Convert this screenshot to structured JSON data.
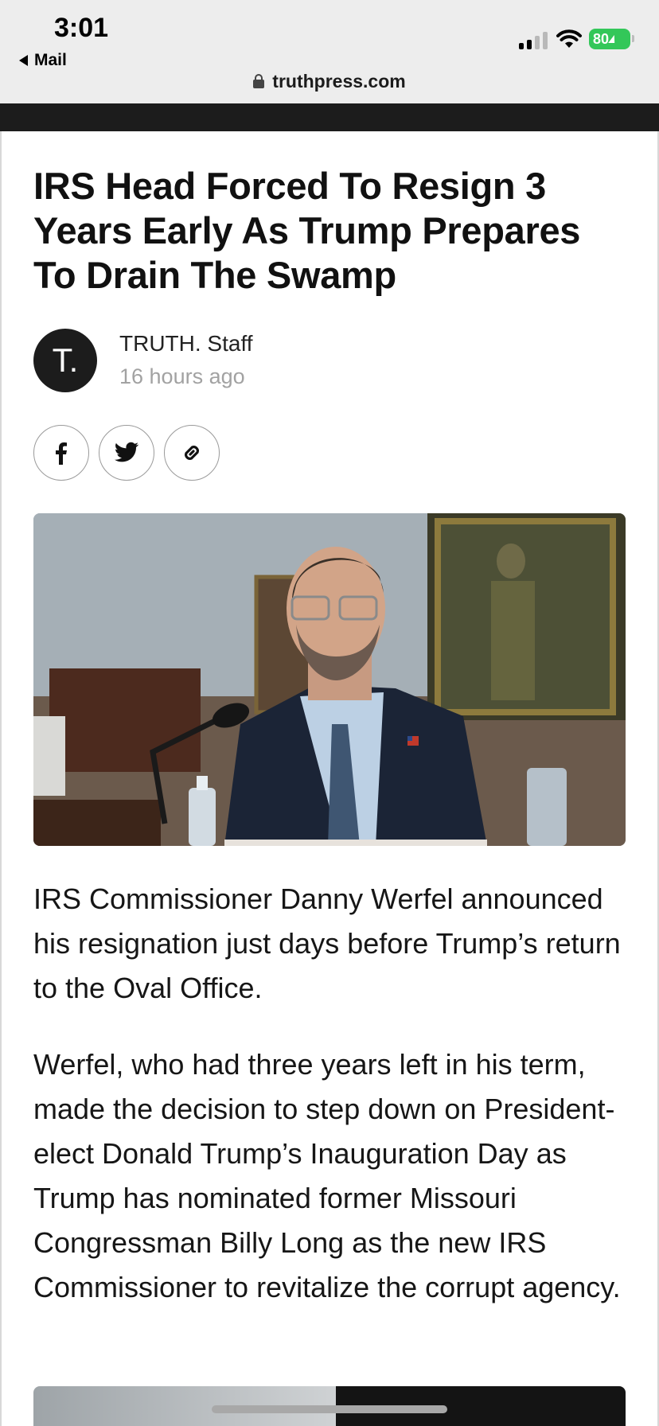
{
  "status_bar": {
    "time": "3:01",
    "back_app": "Mail",
    "battery": "80"
  },
  "browser": {
    "url": "truthpress.com"
  },
  "article": {
    "headline": "IRS Head Forced To Resign 3 Years Early As Trump Prepares To Drain The Swamp",
    "author_initial": "T.",
    "author": "TRUTH. Staff",
    "posted": "16 hours ago",
    "share_icons": [
      "facebook-icon",
      "twitter-icon",
      "link-icon"
    ],
    "paragraphs": [
      "IRS Commissioner Danny Werfel announced his resignation just days before Trump’s return to the Oval Office.",
      "Werfel, who had three years left in his term, made the decision to step down on President-elect Donald Trump’s Inauguration Day as Trump has nominated former Missouri Congressman Billy Long as the new IRS Commissioner to revitalize the corrupt agency."
    ]
  },
  "colors": {
    "status_bg": "#ededed",
    "site_strip": "#1c1c1c",
    "battery_green": "#33c759",
    "meta_gray": "#a2a2a2"
  }
}
